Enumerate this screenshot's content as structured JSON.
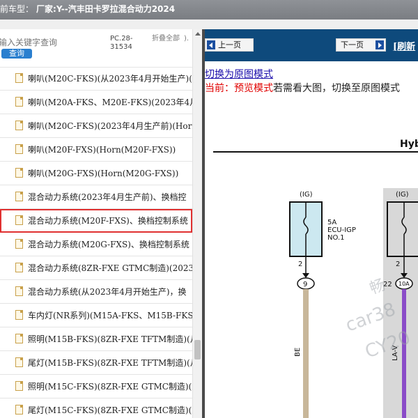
{
  "titlebar": {
    "label": "前车型：",
    "value": "厂家:Y--汽丰田卡罗拉混合动力2024"
  },
  "search": {
    "placeholder": "输入关键字查询",
    "button": "查询"
  },
  "columns": {
    "pc": "PC.28-31534",
    "fold": "折叠全部",
    "k": ")."
  },
  "tree": {
    "items": [
      {
        "label": "喇叭(M20C-FKS)(从2023年4月开始生产)("
      },
      {
        "label": "喇叭(M20A-FKS、M20E-FKS)(2023年4月"
      },
      {
        "label": "喇叭(M20C-FKS)(2023年4月生产前)(Horn"
      },
      {
        "label": "喇叭(M20F-FXS)(Horn(M20F-FXS))"
      },
      {
        "label": "喇叭(M20G-FXS)(Horn(M20G-FXS))"
      },
      {
        "label": "混合动力系统(2023年4月生产前)、换档控"
      },
      {
        "label": "混合动力系统(M20F-FXS)、换档控制系统"
      },
      {
        "label": "混合动力系统(M20G-FXS)、换档控制系统"
      },
      {
        "label": "混合动力系统(8ZR-FXE GTMC制造)(2023"
      },
      {
        "label": "混合动力系统(从2023年4月开始生产)，换"
      },
      {
        "label": "车内灯(NR系列)(M15A-FKS、M15B-FKS"
      },
      {
        "label": "照明(M15B-FKS)(8ZR-FXE TFTM制造)(从"
      },
      {
        "label": "尾灯(M15B-FKS)(8ZR-FXE TFTM制造)(从"
      },
      {
        "label": "照明(M15C-FKS)(8ZR-FXE GTMC制造)(从"
      },
      {
        "label": "尾灯(M15C-FKS)(8ZR-FXE GTMC制造)(从"
      }
    ]
  },
  "viewer": {
    "prev": "上一页",
    "next": "下一页",
    "refresh": "[刷新",
    "switch_link": "切换为原图模式",
    "status_current": "当前：预览模式",
    "status_rest": "若需看大图，切换至原图模式"
  },
  "diagram": {
    "header": "Hyb",
    "fuse1": {
      "tag": "(IG)",
      "amp": "5A",
      "name1": "ECU-IGP",
      "name2": "NO.1",
      "pin": "2",
      "conn": "9",
      "wire": "BE"
    },
    "fuse2": {
      "tag": "(IG)",
      "pin": "2",
      "conn_num": "22",
      "conn": "10A",
      "wire": "LA-V"
    },
    "watermark1": "畅",
    "watermark2": "car38",
    "watermark3": "CY20"
  },
  "colors": {
    "nav": "#0e4a7c",
    "highlight": "#e03030",
    "fuse1_fill": "#cce8f0",
    "fuse2_fill": "#d8d8d8",
    "wire1": "#c8b79a",
    "wire2": "#8a4cc8"
  }
}
